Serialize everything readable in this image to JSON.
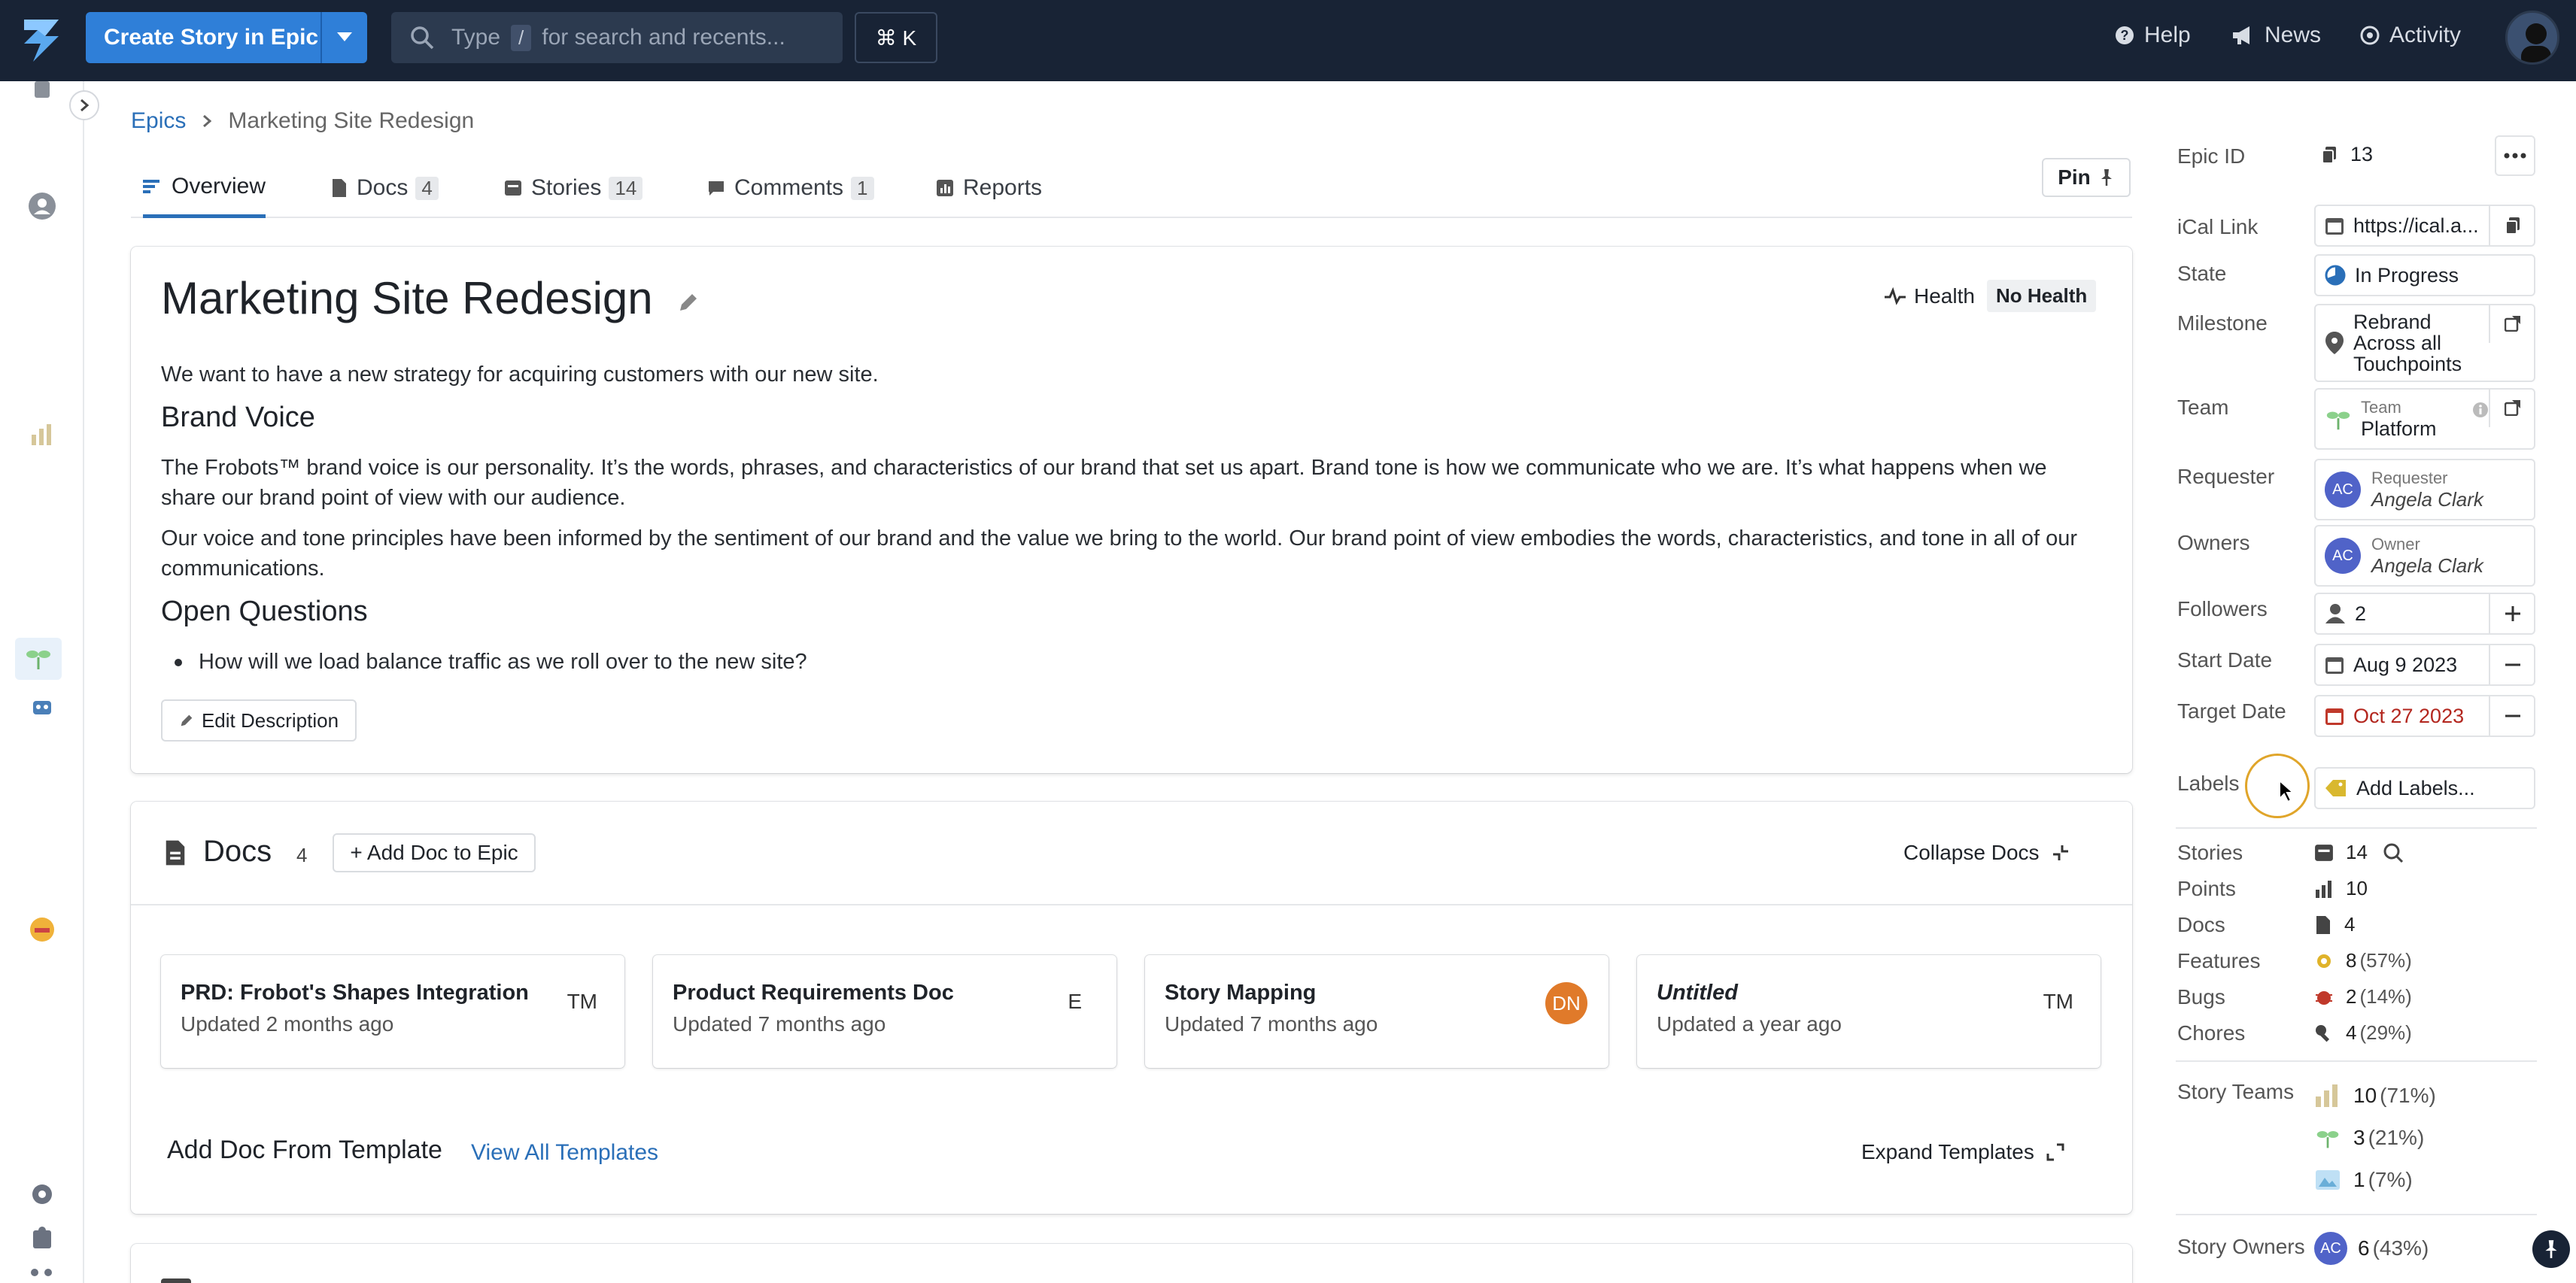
{
  "topbar": {
    "create_label": "Create Story in Epic",
    "search_type": "Type",
    "search_key": "/",
    "search_rest": "for search and recents...",
    "cmdk": "⌘ K",
    "help": "Help",
    "news": "News",
    "activity": "Activity"
  },
  "breadcrumb": {
    "root": "Epics",
    "current": "Marketing Site Redesign"
  },
  "tabs": {
    "overview": "Overview",
    "docs": "Docs",
    "docs_count": "4",
    "stories": "Stories",
    "stories_count": "14",
    "comments": "Comments",
    "comments_count": "1",
    "reports": "Reports",
    "pin": "Pin"
  },
  "epic": {
    "title": "Marketing Site Redesign",
    "health_label": "Health",
    "health_value": "No Health",
    "intro": "We want to have a new strategy for acquiring customers with our new site.",
    "h_brand": "Brand Voice",
    "p_brand1": "The Frobots™ brand voice is our personality. It’s the words, phrases, and characteristics of our brand that set us apart. Brand tone is how we communicate who we are. It’s what happens when we share our brand point of view with our audience.",
    "p_brand2": "Our voice and tone principles have been informed by the sentiment of our brand and the value we bring to the world. Our brand point of view embodies the words, characteristics, and tone in all of our communications.",
    "h_questions": "Open Questions",
    "q1": "How will we load balance traffic as we roll over to the new site?",
    "edit_description": "Edit Description"
  },
  "docs": {
    "heading": "Docs",
    "count": "4",
    "add_doc": "+ Add Doc to Epic",
    "collapse": "Collapse Docs",
    "items": [
      {
        "title": "PRD: Frobot's Shapes Integration",
        "updated": "Updated 2 months ago",
        "owner": "TM"
      },
      {
        "title": "Product Requirements Doc",
        "updated": "Updated 7 months ago",
        "owner": "E"
      },
      {
        "title": "Story Mapping",
        "updated": "Updated 7 months ago",
        "owner": "DN"
      },
      {
        "title": "Untitled",
        "updated": "Updated a year ago",
        "owner": "TM"
      }
    ],
    "template_heading": "Add Doc From Template",
    "view_templates": "View All Templates",
    "expand_templates": "Expand Templates"
  },
  "sidebar": {
    "epic_id_label": "Epic ID",
    "epic_id": "13",
    "ical_label": "iCal Link",
    "ical": "https://ical.a...",
    "state_label": "State",
    "state": "In Progress",
    "milestone_label": "Milestone",
    "milestone": "Rebrand Across all Touchpoints",
    "team_label": "Team",
    "team_sub": "Team",
    "team": "Platform",
    "requester_label": "Requester",
    "requester_sub": "Requester",
    "requester": "Angela Clark",
    "requester_initials": "AC",
    "owners_label": "Owners",
    "owner_sub": "Owner",
    "owner": "Angela Clark",
    "owner_initials": "AC",
    "followers_label": "Followers",
    "followers": "2",
    "start_label": "Start Date",
    "start": "Aug 9 2023",
    "target_label": "Target Date",
    "target": "Oct 27 2023",
    "labels_label": "Labels",
    "labels": "Add Labels...",
    "stories_label": "Stories",
    "stories": "14",
    "points_label": "Points",
    "points": "10",
    "docs_label": "Docs",
    "docs": "4",
    "features_label": "Features",
    "features": "8",
    "features_pct": "(57%)",
    "bugs_label": "Bugs",
    "bugs": "2",
    "bugs_pct": "(14%)",
    "chores_label": "Chores",
    "chores": "4",
    "chores_pct": "(29%)",
    "story_teams_label": "Story Teams",
    "team1": "10",
    "team1_pct": "(71%)",
    "team2": "3",
    "team2_pct": "(21%)",
    "team3": "1",
    "team3_pct": "(7%)",
    "story_owners_label": "Story Owners",
    "so1": "6",
    "so1_pct": "(43%)",
    "so1_initials": "AC"
  },
  "colors": {
    "topbar": "#182335",
    "accent": "#2f7fd8",
    "link": "#2a6fb8",
    "target_date": "#b3261e"
  }
}
